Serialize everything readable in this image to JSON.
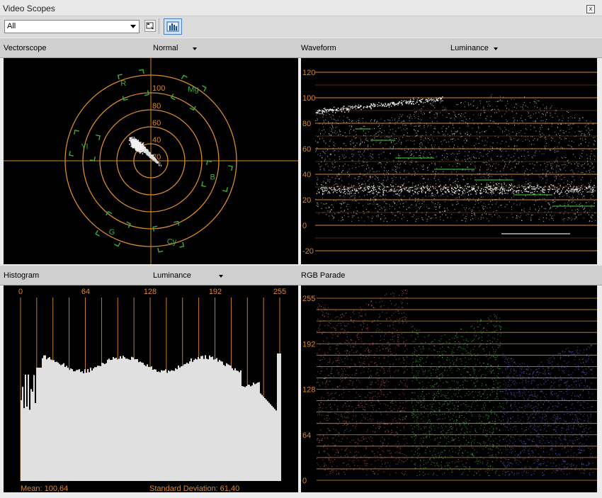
{
  "window": {
    "title": "Video Scopes",
    "close_glyph": "x"
  },
  "toolbar": {
    "scope_select": "All",
    "buttons": [
      "scope-options-icon",
      "parade-view-icon"
    ]
  },
  "vectorscope": {
    "label": "Vectorscope",
    "mode": "Normal",
    "ring_labels": [
      "20",
      "40",
      "60",
      "80",
      "100"
    ],
    "targets": [
      "R",
      "Mg",
      "Yl",
      "B",
      "G",
      "Cy"
    ],
    "accent": "#d98a2a",
    "target_color": "#3ab03a"
  },
  "waveform": {
    "label": "Waveform",
    "mode": "Luminance",
    "scale": [
      "120",
      "100",
      "80",
      "60",
      "40",
      "20",
      "0",
      "-20"
    ]
  },
  "histogram": {
    "label": "Histogram",
    "mode": "Luminance",
    "scale": [
      "0",
      "64",
      "128",
      "192",
      "255"
    ],
    "mean": "Mean: 100,64",
    "std": "Standard Deviation: 61,40"
  },
  "rgb_parade": {
    "label": "RGB Parade",
    "scale": [
      "255",
      "192",
      "128",
      "64",
      "0"
    ],
    "colors": {
      "red": "#c96a62",
      "green": "#4fc24f",
      "blue": "#6a6ad8"
    }
  }
}
